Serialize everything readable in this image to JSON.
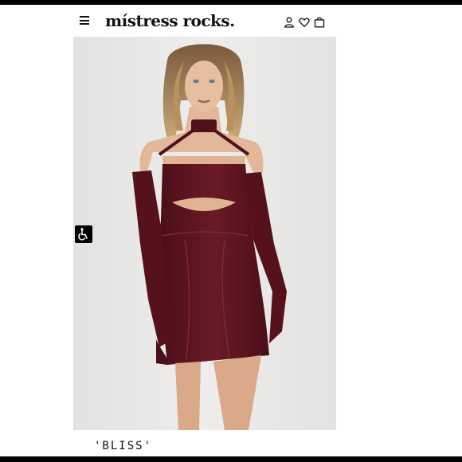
{
  "header": {
    "menu_icon": "hamburger-menu-icon",
    "logo_text": "místress rocks.",
    "account_icon": "user-icon",
    "wishlist_icon": "heart-icon",
    "bag_icon": "shopping-bag-icon"
  },
  "product": {
    "image_alt": "Model wearing burgundy mesh cut-out mini dress with choker and gloves",
    "name": "'BLISS'",
    "colors": {
      "dress": "#5a1420",
      "background": "#e9e8e6"
    }
  },
  "accessibility": {
    "icon": "wheelchair-accessibility-icon"
  }
}
